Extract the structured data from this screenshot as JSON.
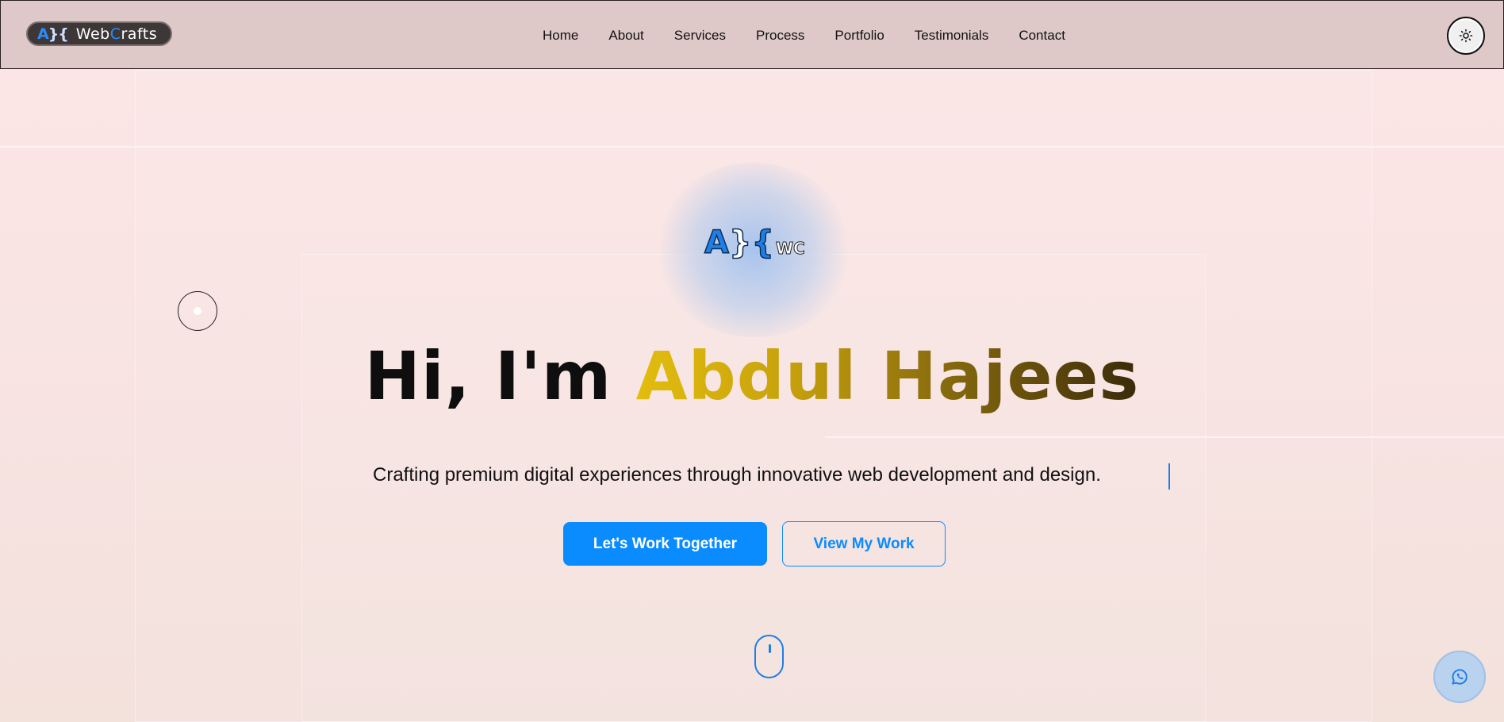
{
  "brand": {
    "mark_a": "A",
    "mark_b": "}{",
    "name_part1": "Web",
    "name_part2": "C",
    "name_part3": "rafts"
  },
  "nav": {
    "items": [
      {
        "label": "Home"
      },
      {
        "label": "About"
      },
      {
        "label": "Services"
      },
      {
        "label": "Process"
      },
      {
        "label": "Portfolio"
      },
      {
        "label": "Testimonials"
      },
      {
        "label": "Contact"
      }
    ],
    "theme_toggle_icon": "sun-icon"
  },
  "hero": {
    "logo_a": "A",
    "logo_b": "}",
    "logo_c": "{",
    "logo_wc": "WC",
    "greeting": "Hi, I'm ",
    "name": "Abdul Hajees",
    "tagline": "Crafting premium digital experiences through innovative web development and design.",
    "primary_cta": "Let's Work Together",
    "secondary_cta": "View My Work"
  },
  "colors": {
    "accent": "#0a8cff",
    "name_gradient_start": "#e2bd0e",
    "name_gradient_end": "#3a2a0a",
    "navbar_bg": "#dec9c8"
  },
  "floating": {
    "whatsapp_icon": "whatsapp-icon",
    "scroll_icon": "mouse-scroll-icon"
  }
}
